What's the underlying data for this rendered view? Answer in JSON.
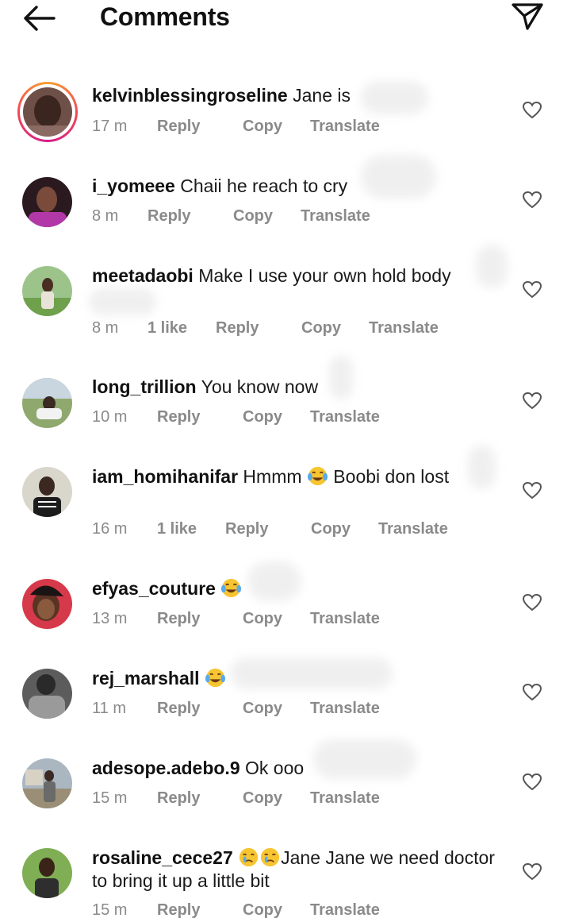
{
  "header": {
    "title": "Comments",
    "back_icon": "arrow-left-icon",
    "share_icon": "paper-plane-icon"
  },
  "actions": {
    "reply": "Reply",
    "copy": "Copy",
    "translate": "Translate"
  },
  "comments": [
    {
      "username": "kelvinblessingroseline",
      "text": " Jane is",
      "time": "17 m",
      "likes": ""
    },
    {
      "username": "i_yomeee",
      "text": " Chaii he reach to cry",
      "time": "8 m",
      "likes": ""
    },
    {
      "username": "meetadaobi",
      "text": " Make I use your own hold body",
      "time": "8 m",
      "likes": "1 like"
    },
    {
      "username": "long_trillion",
      "text": " You know now",
      "time": "10 m",
      "likes": ""
    },
    {
      "username": "iam_homihanifar",
      "text": " Hmmm ",
      "text2": " Boobi don lost",
      "time": "16 m",
      "likes": "1 like"
    },
    {
      "username": "efyas_couture",
      "text": " ",
      "time": "13 m",
      "likes": ""
    },
    {
      "username": "rej_marshall",
      "text": " ",
      "time": "11 m",
      "likes": ""
    },
    {
      "username": "adesope.adebo.9",
      "text": " Ok ooo",
      "time": "15 m",
      "likes": ""
    },
    {
      "username": "rosaline_cece27",
      "text": "Jane Jane we need doctor to bring it up a little bit",
      "time": "15 m",
      "likes": ""
    }
  ]
}
